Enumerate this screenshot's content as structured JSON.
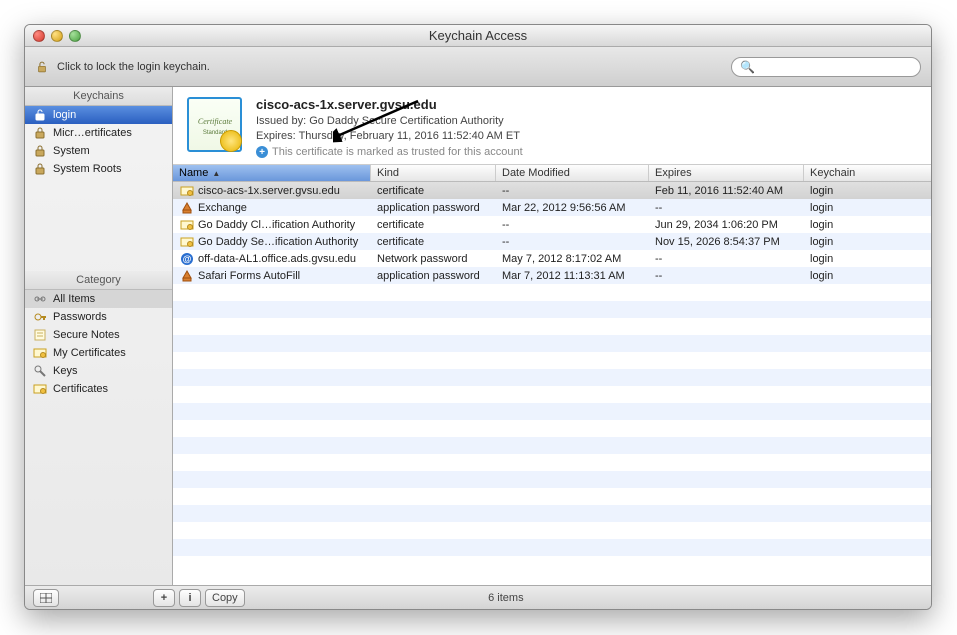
{
  "window": {
    "title": "Keychain Access"
  },
  "toolbar": {
    "lock_message": "Click to lock the login keychain."
  },
  "search": {
    "placeholder": ""
  },
  "sidebar": {
    "keychains_header": "Keychains",
    "keychains": [
      {
        "label": "login",
        "icon": "unlocked-padlock-icon",
        "selected": true
      },
      {
        "label": "Micr…ertificates",
        "icon": "locked-padlock-icon",
        "selected": false
      },
      {
        "label": "System",
        "icon": "locked-padlock-icon",
        "selected": false
      },
      {
        "label": "System Roots",
        "icon": "locked-padlock-icon",
        "selected": false
      }
    ],
    "category_header": "Category",
    "categories": [
      {
        "label": "All Items",
        "icon": "all-items-icon",
        "selected": true
      },
      {
        "label": "Passwords",
        "icon": "passwords-icon",
        "selected": false
      },
      {
        "label": "Secure Notes",
        "icon": "secure-notes-icon",
        "selected": false
      },
      {
        "label": "My Certificates",
        "icon": "my-certificates-icon",
        "selected": false
      },
      {
        "label": "Keys",
        "icon": "keys-icon",
        "selected": false
      },
      {
        "label": "Certificates",
        "icon": "certificates-icon",
        "selected": false
      }
    ]
  },
  "detail": {
    "name": "cisco-acs-1x.server.gvsu.edu",
    "issued_by": "Issued by: Go Daddy Secure Certification Authority",
    "expires": "Expires: Thursday, February 11, 2016 11:52:40 AM ET",
    "trust": "This certificate is marked as trusted for this account"
  },
  "table": {
    "columns": {
      "name": "Name",
      "kind": "Kind",
      "date_modified": "Date Modified",
      "expires": "Expires",
      "keychain": "Keychain"
    },
    "sort_column": "name",
    "rows": [
      {
        "icon": "certificate-row-icon",
        "name": "cisco-acs-1x.server.gvsu.edu",
        "kind": "certificate",
        "date_modified": "--",
        "expires": "Feb 11, 2016 11:52:40 AM",
        "keychain": "login",
        "selected": true
      },
      {
        "icon": "application-icon",
        "name": "Exchange",
        "kind": "application password",
        "date_modified": "Mar 22, 2012 9:56:56 AM",
        "expires": "--",
        "keychain": "login",
        "selected": false
      },
      {
        "icon": "certificate-row-icon",
        "name": "Go Daddy Cl…ification Authority",
        "kind": "certificate",
        "date_modified": "--",
        "expires": "Jun 29, 2034 1:06:20 PM",
        "keychain": "login",
        "selected": false
      },
      {
        "icon": "certificate-row-icon",
        "name": "Go Daddy Se…ification Authority",
        "kind": "certificate",
        "date_modified": "--",
        "expires": "Nov 15, 2026 8:54:37 PM",
        "keychain": "login",
        "selected": false
      },
      {
        "icon": "at-icon",
        "name": "off-data-AL1.office.ads.gvsu.edu",
        "kind": "Network password",
        "date_modified": "May 7, 2012 8:17:02 AM",
        "expires": "--",
        "keychain": "login",
        "selected": false
      },
      {
        "icon": "application-icon",
        "name": "Safari Forms AutoFill",
        "kind": "application password",
        "date_modified": "Mar 7, 2012 11:13:31 AM",
        "expires": "--",
        "keychain": "login",
        "selected": false
      }
    ]
  },
  "statusbar": {
    "item_count": "6 items",
    "copy_label": "Copy"
  }
}
